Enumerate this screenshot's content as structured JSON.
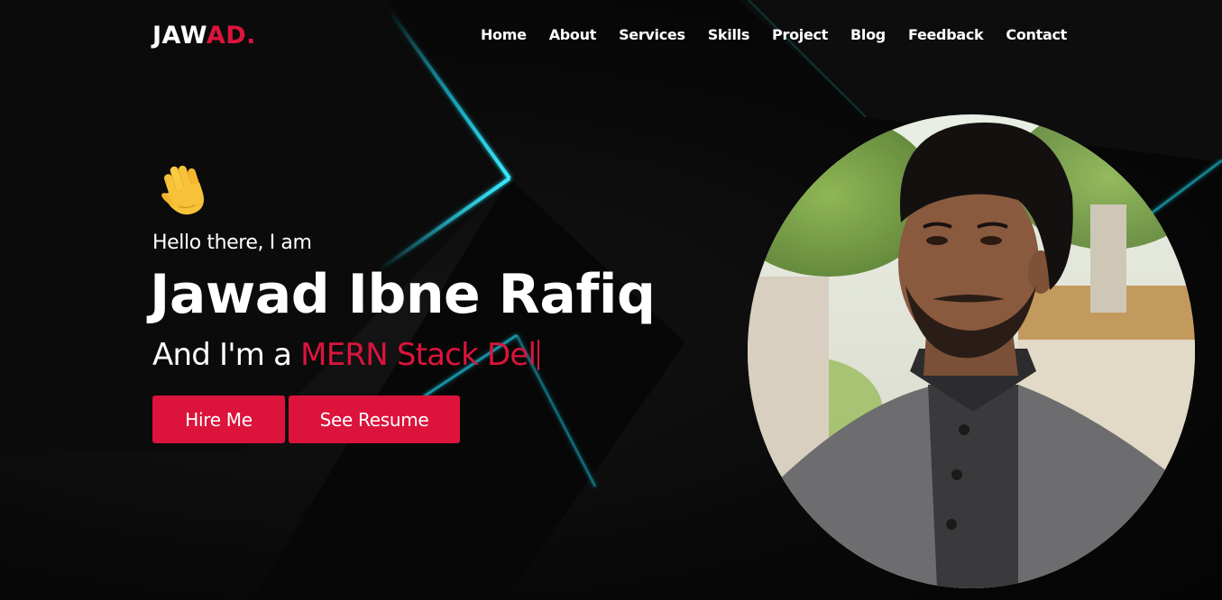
{
  "brand": {
    "logo_part1": "JAW",
    "logo_part2": "AD.",
    "accent_color": "#dc143c",
    "glow_color": "#1fd6f0"
  },
  "nav": {
    "items": [
      {
        "label": "Home"
      },
      {
        "label": "About"
      },
      {
        "label": "Services"
      },
      {
        "label": "Skills"
      },
      {
        "label": "Project"
      },
      {
        "label": "Blog"
      },
      {
        "label": "Feedback"
      },
      {
        "label": "Contact"
      }
    ]
  },
  "hero": {
    "wave_icon": "waving-hand-emoji",
    "greeting": "Hello there, I am",
    "name": "Jawad Ibne Rafiq",
    "role_prefix": "And I'm a ",
    "role_typed": "MERN Stack Del",
    "buttons": {
      "hire_label": "Hire Me",
      "resume_label": "See Resume"
    }
  },
  "portrait": {
    "icon": "profile-photo"
  }
}
